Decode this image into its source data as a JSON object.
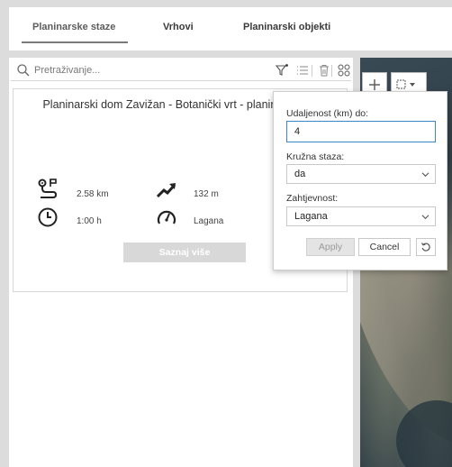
{
  "tabs": [
    {
      "label": "Planinarske staze",
      "active": true
    },
    {
      "label": "Vrhovi",
      "active": false
    },
    {
      "label": "Planinarski objekti",
      "active": false
    }
  ],
  "search": {
    "placeholder": "Pretraživanje..."
  },
  "toolbar_icons": [
    "filter-icon",
    "list-icon",
    "trash-icon",
    "grid-icon"
  ],
  "card": {
    "title": "Planinarski dom Zavižan - Botanički vrt - planin Zavižan",
    "distance": "2.58 km",
    "elevation": "132 m",
    "duration": "1:00 h",
    "difficulty": "Lagana",
    "more_label": "Saznaj više"
  },
  "filter": {
    "distance_label": "Udaljenost (km) do:",
    "distance_value": "4",
    "circular_label": "Kružna staza:",
    "circular_value": "da",
    "difficulty_label": "Zahtjevnost:",
    "difficulty_value": "Lagana",
    "apply_label": "Apply",
    "cancel_label": "Cancel"
  },
  "colors": {
    "accent": "#3e86c8",
    "disabled_button": "#d8d8d8",
    "tab_underline": "#7a7a7a"
  }
}
